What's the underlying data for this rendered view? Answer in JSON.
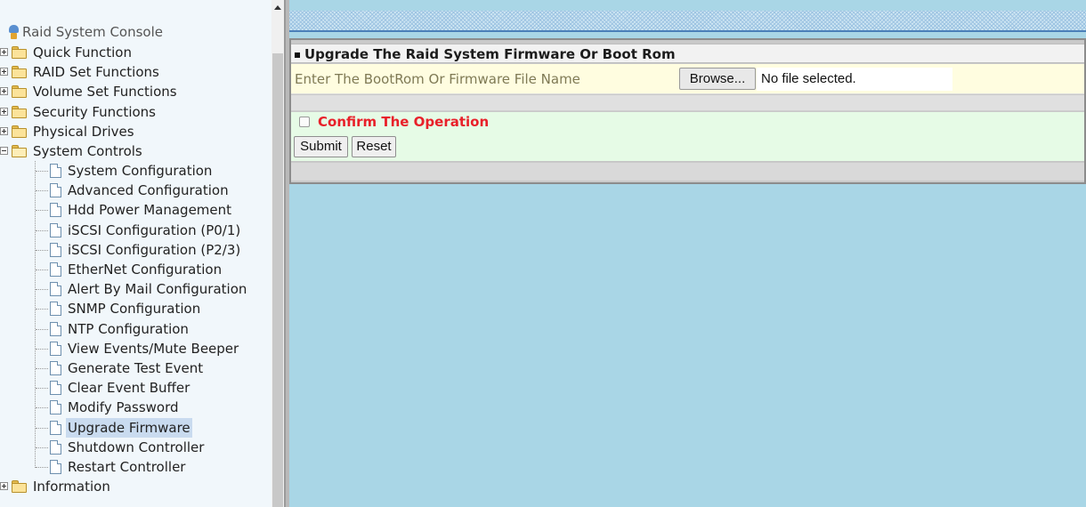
{
  "tree": {
    "root_label": "Raid System Console",
    "top_items": [
      {
        "label": "Quick Function",
        "expanded": false
      },
      {
        "label": "RAID Set Functions",
        "expanded": false
      },
      {
        "label": "Volume Set Functions",
        "expanded": false
      },
      {
        "label": "Security Functions",
        "expanded": false
      },
      {
        "label": "Physical Drives",
        "expanded": false
      },
      {
        "label": "System Controls",
        "expanded": true
      }
    ],
    "children": [
      "System Configuration",
      "Advanced Configuration",
      "Hdd Power Management",
      "iSCSI Configuration (P0/1)",
      "iSCSI Configuration (P2/3)",
      "EtherNet Configuration",
      "Alert By Mail Configuration",
      "SNMP Configuration",
      "NTP Configuration",
      "View Events/Mute Beeper",
      "Generate Test Event",
      "Clear Event Buffer",
      "Modify Password",
      "Upgrade Firmware",
      "Shutdown Controller",
      "Restart Controller"
    ],
    "selected": "Upgrade Firmware",
    "last_item": "Information"
  },
  "panel": {
    "title": "Upgrade The Raid System Firmware Or Boot Rom",
    "file_label": "Enter The BootRom Or Firmware File Name",
    "browse_label": "Browse...",
    "file_status": "No file selected.",
    "confirm_label": "Confirm The Operation",
    "confirm_checked": false,
    "submit_label": "Submit",
    "reset_label": "Reset"
  },
  "colors": {
    "content_bg": "#a9d6e6",
    "confirm_text": "#e8202a",
    "selected_bg": "#c9dbef"
  }
}
